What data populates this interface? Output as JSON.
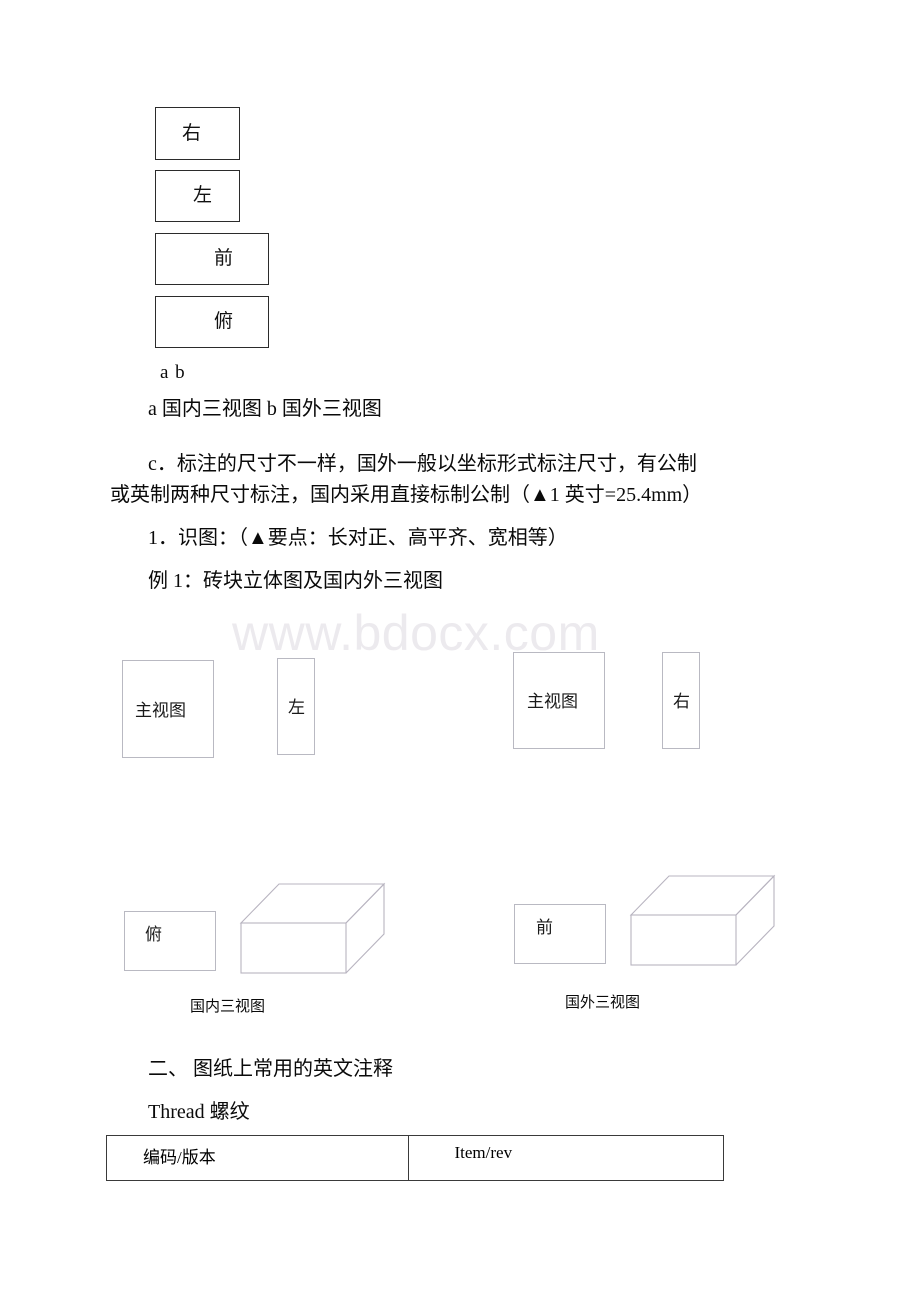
{
  "document": {
    "watermark": "www.bdocx.com",
    "top_view_boxes": [
      {
        "label": "右",
        "name": "right-view-box"
      },
      {
        "label": "左",
        "name": "left-view-box"
      },
      {
        "label": "前",
        "name": "front-view-box"
      },
      {
        "label": "俯",
        "name": "top-view-box"
      }
    ],
    "figure_label_line": "a b",
    "figure_caption_line": "a 国内三视图 b 国外三视图",
    "paragraph_c": {
      "line1": "c．标注的尺寸不一样，国外一般以坐标形式标注尺寸，有公制",
      "line2": "或英制两种尺寸标注，国内采用直接标制公制（▲1 英寸=25.4mm）"
    },
    "item_1": "1．识图：（▲要点：长对正、高平齐、宽相等）",
    "example_1": "例 1：砖块立体图及国内外三视图",
    "projection_figure": {
      "domestic": {
        "main_view": "主视图",
        "side_view": "左",
        "top_view": "俯",
        "caption": "国内三视图"
      },
      "foreign": {
        "main_view": "主视图",
        "side_view": "右",
        "top_view": "前",
        "caption": "国外三视图"
      }
    },
    "section_2_heading": "二、 图纸上常用的英文注释",
    "glossary_entry": "Thread 螺纹",
    "table": {
      "rows": [
        {
          "col1": "编码/版本",
          "col2": "Item/rev"
        }
      ]
    }
  }
}
